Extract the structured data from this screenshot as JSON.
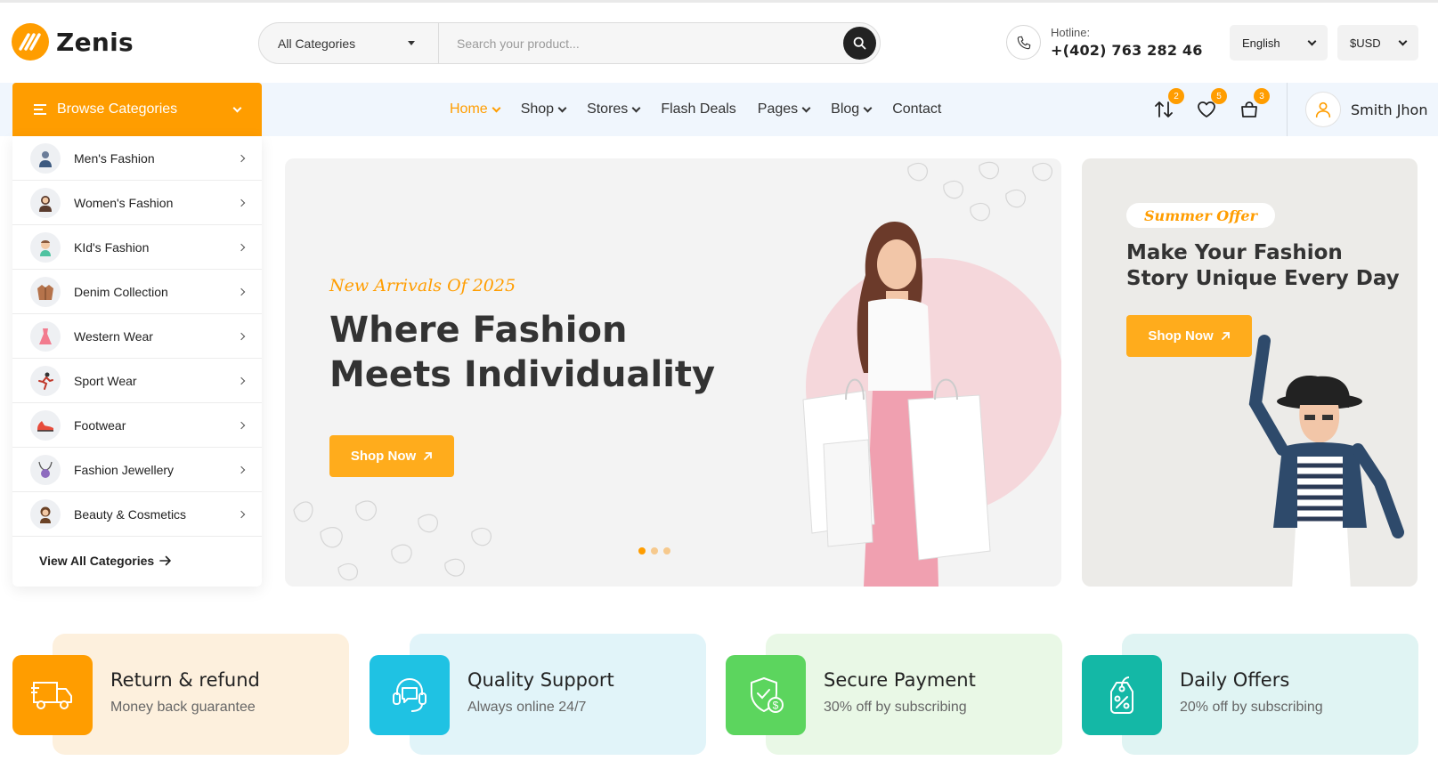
{
  "brand": {
    "name": "Zenis",
    "accent": "#ff9d00"
  },
  "search": {
    "category": "All Categories",
    "placeholder": "Search your product..."
  },
  "hotline": {
    "label": "Hotline:",
    "number": "+(402) 763 282 46"
  },
  "language": "English",
  "currency": "$USD",
  "browse": {
    "label": "Browse Categories"
  },
  "nav": {
    "items": [
      {
        "label": "Home",
        "dropdown": true,
        "active": true
      },
      {
        "label": "Shop",
        "dropdown": true
      },
      {
        "label": "Stores",
        "dropdown": true
      },
      {
        "label": "Flash Deals",
        "dropdown": false
      },
      {
        "label": "Pages",
        "dropdown": true
      },
      {
        "label": "Blog",
        "dropdown": true
      },
      {
        "label": "Contact",
        "dropdown": false
      }
    ],
    "compare_count": "2",
    "wishlist_count": "5",
    "cart_count": "3"
  },
  "user": {
    "name": "Smith Jhon"
  },
  "categories": [
    {
      "label": "Men's Fashion",
      "icon": "man-icon"
    },
    {
      "label": "Women's Fashion",
      "icon": "woman-icon"
    },
    {
      "label": "KId's Fashion",
      "icon": "kid-icon"
    },
    {
      "label": "Denim Collection",
      "icon": "jacket-icon"
    },
    {
      "label": "Western Wear",
      "icon": "dress-icon"
    },
    {
      "label": "Sport Wear",
      "icon": "sport-icon"
    },
    {
      "label": "Footwear",
      "icon": "shoe-icon"
    },
    {
      "label": "Fashion Jewellery",
      "icon": "necklace-icon"
    },
    {
      "label": "Beauty & Cosmetics",
      "icon": "beauty-icon"
    }
  ],
  "view_all": "View All Categories",
  "hero": {
    "subtitle": "New Arrivals Of 2025",
    "title": "Where Fashion Meets Individuality",
    "button": "Shop Now",
    "active_slide": 1,
    "slides": 3
  },
  "promo": {
    "tag": "Summer Offer",
    "title": "Make Your Fashion Story Unique Every Day",
    "button": "Shop Now"
  },
  "features": [
    {
      "title": "Return & refund",
      "subtitle": "Money back guarantee",
      "icon": "truck-icon",
      "color": "#ff9d00",
      "bg": "#fdf0dd"
    },
    {
      "title": "Quality Support",
      "subtitle": "Always online 24/7",
      "icon": "support-icon",
      "color": "#1fc2e3",
      "bg": "#e1f4f9"
    },
    {
      "title": "Secure Payment",
      "subtitle": "30% off by subscribing",
      "icon": "shield-payment-icon",
      "color": "#5cd55e",
      "bg": "#e9f8e6"
    },
    {
      "title": "Daily Offers",
      "subtitle": "20% off by subscribing",
      "icon": "discount-tag-icon",
      "color": "#14b8a6",
      "bg": "#e0f4f3"
    }
  ]
}
